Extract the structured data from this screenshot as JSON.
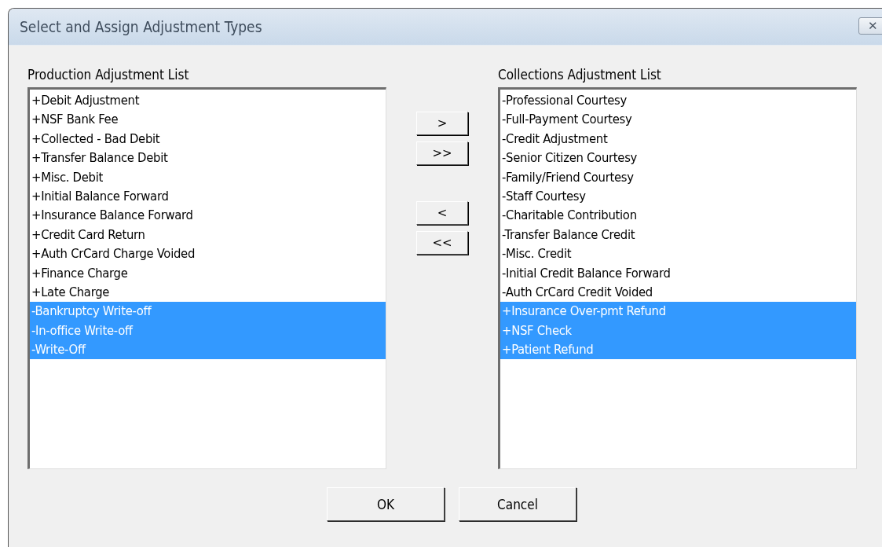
{
  "window": {
    "title": "Select and Assign Adjustment Types",
    "close_button": "✕"
  },
  "lists": [
    {
      "label": "Production Adjustment List",
      "items": [
        {
          "text": "+Debit Adjustment",
          "selected": false
        },
        {
          "text": "+NSF Bank Fee",
          "selected": false
        },
        {
          "text": "+Collected - Bad Debit",
          "selected": false
        },
        {
          "text": "+Transfer Balance Debit",
          "selected": false
        },
        {
          "text": "+Misc. Debit",
          "selected": false
        },
        {
          "text": "+Initial Balance Forward",
          "selected": false
        },
        {
          "text": "+Insurance Balance Forward",
          "selected": false
        },
        {
          "text": "+Credit Card Return",
          "selected": false
        },
        {
          "text": "+Auth CrCard Charge Voided",
          "selected": false
        },
        {
          "text": "+Finance Charge",
          "selected": false
        },
        {
          "text": "+Late Charge",
          "selected": false
        },
        {
          "text": "-Bankruptcy Write-off",
          "selected": true
        },
        {
          "text": "-In-office Write-off",
          "selected": true
        },
        {
          "text": "-Write-Off",
          "selected": true
        }
      ]
    },
    {
      "label": "Collections Adjustment List",
      "items": [
        {
          "text": "-Professional Courtesy",
          "selected": false
        },
        {
          "text": "-Full-Payment Courtesy",
          "selected": false
        },
        {
          "text": "-Credit Adjustment",
          "selected": false
        },
        {
          "text": "-Senior Citizen Courtesy",
          "selected": false
        },
        {
          "text": "-Family/Friend Courtesy",
          "selected": false
        },
        {
          "text": "-Staff Courtesy",
          "selected": false
        },
        {
          "text": "-Charitable Contribution",
          "selected": false
        },
        {
          "text": "-Transfer Balance Credit",
          "selected": false
        },
        {
          "text": "-Misc. Credit",
          "selected": false
        },
        {
          "text": "-Initial Credit Balance Forward",
          "selected": false
        },
        {
          "text": "-Auth CrCard Credit Voided",
          "selected": false
        },
        {
          "text": "+Insurance Over-pmt Refund",
          "selected": true
        },
        {
          "text": "+NSF Check",
          "selected": true
        },
        {
          "text": "+Patient Refund",
          "selected": true
        }
      ]
    }
  ],
  "move_buttons": [
    ">",
    ">>",
    "<",
    "<<"
  ],
  "buttons": [
    "OK",
    "Cancel"
  ]
}
